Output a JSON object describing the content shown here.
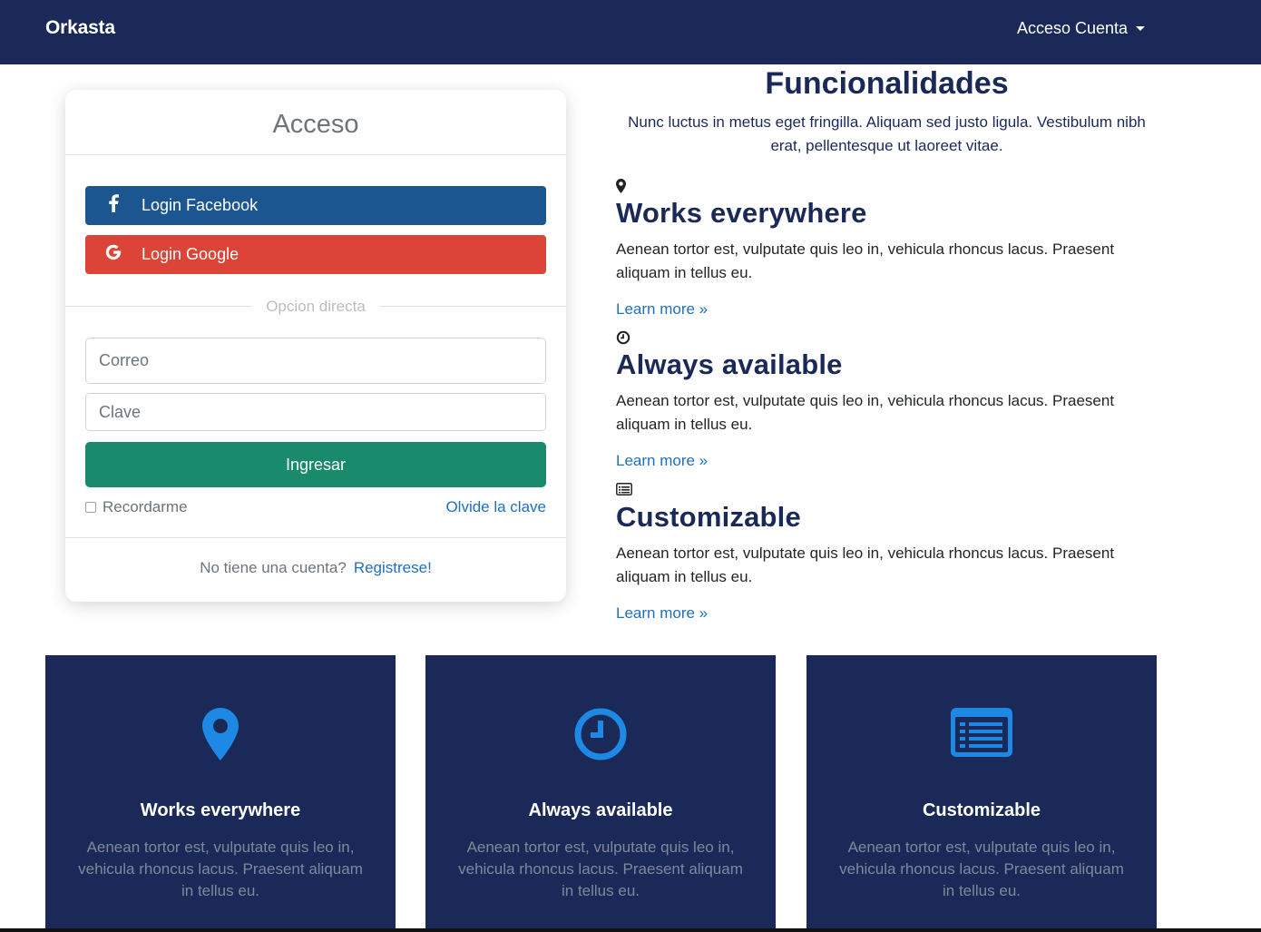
{
  "nav": {
    "brand": "Orkasta",
    "account_label": "Acceso Cuenta"
  },
  "login": {
    "title": "Acceso",
    "facebook_label": "Login Facebook",
    "google_label": "Login Google",
    "divider_text": "Opcion directa",
    "email_placeholder": "Correo",
    "password_placeholder": "Clave",
    "submit_label": "Ingresar",
    "remember_label": "Recordarme",
    "forgot_label": "Olvide la clave",
    "signup_text": "No tiene una cuenta?",
    "signup_link": "Registrese!"
  },
  "features": {
    "title": "Funcionalidades",
    "subtitle": "Nunc luctus in metus eget fringilla. Aliquam sed justo ligula. Vestibulum nibh erat, pellentesque ut laoreet vitae.",
    "items": [
      {
        "icon": "map-marker-icon",
        "title": "Works everywhere",
        "text": "Aenean tortor est, vulputate quis leo in, vehicula rhoncus lacus. Praesent aliquam in tellus eu.",
        "link": "Learn more »"
      },
      {
        "icon": "clock-icon",
        "title": "Always available",
        "text": "Aenean tortor est, vulputate quis leo in, vehicula rhoncus lacus. Praesent aliquam in tellus eu.",
        "link": "Learn more »"
      },
      {
        "icon": "list-icon",
        "title": "Customizable",
        "text": "Aenean tortor est, vulputate quis leo in, vehicula rhoncus lacus. Praesent aliquam in tellus eu.",
        "link": "Learn more »"
      }
    ]
  },
  "tiles": [
    {
      "icon": "map-marker-icon",
      "title": "Works everywhere",
      "text": "Aenean tortor est, vulputate quis leo in, vehicula rhoncus lacus. Praesent aliquam in tellus eu."
    },
    {
      "icon": "clock-icon",
      "title": "Always available",
      "text": "Aenean tortor est, vulputate quis leo in, vehicula rhoncus lacus. Praesent aliquam in tellus eu."
    },
    {
      "icon": "list-icon",
      "title": "Customizable",
      "text": "Aenean tortor est, vulputate quis leo in, vehicula rhoncus lacus. Praesent aliquam in tellus eu."
    }
  ],
  "colors": {
    "navbar": "#1b2958",
    "facebook": "#1c5690",
    "google": "#db4437",
    "submit": "#1a8a6c",
    "link": "#1f6fbf",
    "tile_icon": "#1e88e5"
  }
}
